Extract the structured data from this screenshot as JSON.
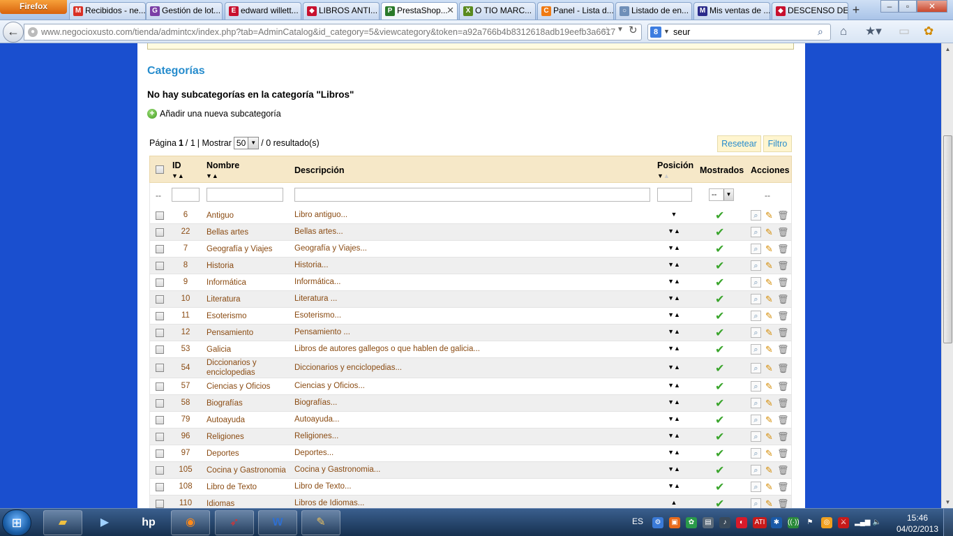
{
  "browser": {
    "menu_label": "Firefox",
    "tabs": [
      {
        "label": "Recibidos - ne...",
        "icon": "gmail-icon",
        "color": "#d93025",
        "glyph": "M"
      },
      {
        "label": "Gestión de lot...",
        "icon": "purple-app-icon",
        "color": "#7b3fa6",
        "glyph": "G"
      },
      {
        "label": "edward willett...",
        "icon": "red-bird-icon",
        "color": "#c8102e",
        "glyph": "E"
      },
      {
        "label": "LIBROS ANTI...",
        "icon": "red-diamond-icon",
        "color": "#c8102e",
        "glyph": "◆"
      },
      {
        "label": "PrestaShop...",
        "icon": "prestashop-icon",
        "color": "#2a7a2a",
        "glyph": "P"
      },
      {
        "label": "O TIO MARC...",
        "icon": "green-x-icon",
        "color": "#5a8a1e",
        "glyph": "X"
      },
      {
        "label": "Panel - Lista d...",
        "icon": "orange-app-icon",
        "color": "#f07a12",
        "glyph": "C"
      },
      {
        "label": "Listado de en...",
        "icon": "globe-icon",
        "color": "#6f8fb8",
        "glyph": "○"
      },
      {
        "label": "Mis ventas de ...",
        "icon": "shop-icon",
        "color": "#2a2a8a",
        "glyph": "M"
      },
      {
        "label": "DESCENSO DE...",
        "icon": "red-diamond-icon",
        "color": "#c8102e",
        "glyph": "◆"
      }
    ],
    "new_tab_label": "+",
    "url_host": "www.negocioxusto.com",
    "url_path": "/tienda/admintcx/index.php?tab=AdminCatalog&id_category=5&viewcategory&token=a92a766b4b8312618adb19eefb3a6617",
    "search_value": "seur"
  },
  "page": {
    "heading": "Categorías",
    "no_subcats": "No hay subcategorías en la categoría \"Libros\"",
    "add_subcat": "Añadir una nueva subcategoría",
    "pager": {
      "page_label": "Página",
      "page_current": "1",
      "page_total": "/ 1",
      "show_label": "| Mostrar",
      "show_value": "50",
      "results": "/ 0 resultado(s)"
    },
    "reset_label": "Resetear",
    "filter_label": "Filtro",
    "columns": {
      "id": "ID",
      "name": "Nombre",
      "description": "Descripción",
      "position": "Posición",
      "displayed": "Mostrados",
      "actions": "Acciones"
    },
    "filter_dash": "--",
    "displayed_select": "--",
    "rows": [
      {
        "id": "6",
        "name": "Antiguo",
        "desc": "Libro antiguo...",
        "pos": "▼"
      },
      {
        "id": "22",
        "name": "Bellas artes",
        "desc": "Bellas artes...",
        "pos": "▼▲"
      },
      {
        "id": "7",
        "name": "Geografía y Viajes",
        "desc": "Geografía y Viajes...",
        "pos": "▼▲"
      },
      {
        "id": "8",
        "name": "Historia",
        "desc": "Historia...",
        "pos": "▼▲"
      },
      {
        "id": "9",
        "name": "Informática",
        "desc": "Informática...",
        "pos": "▼▲"
      },
      {
        "id": "10",
        "name": "Literatura",
        "desc": "Literatura ...",
        "pos": "▼▲"
      },
      {
        "id": "11",
        "name": "Esoterismo",
        "desc": "Esoterismo...",
        "pos": "▼▲"
      },
      {
        "id": "12",
        "name": "Pensamiento",
        "desc": "Pensamiento ...",
        "pos": "▼▲"
      },
      {
        "id": "53",
        "name": "Galicia",
        "desc": "Libros de autores gallegos o que hablen de galicia...",
        "pos": "▼▲"
      },
      {
        "id": "54",
        "name": "Diccionarios y enciclopedias",
        "desc": "Diccionarios y enciclopedias...",
        "pos": "▼▲"
      },
      {
        "id": "57",
        "name": "Ciencias y Oficios",
        "desc": "Ciencias y Oficios...",
        "pos": "▼▲"
      },
      {
        "id": "58",
        "name": "Biografías",
        "desc": "Biografías...",
        "pos": "▼▲"
      },
      {
        "id": "79",
        "name": "Autoayuda",
        "desc": "Autoayuda...",
        "pos": "▼▲"
      },
      {
        "id": "96",
        "name": "Religiones",
        "desc": "Religiones...",
        "pos": "▼▲"
      },
      {
        "id": "97",
        "name": "Deportes",
        "desc": "Deportes...",
        "pos": "▼▲"
      },
      {
        "id": "105",
        "name": "Cocina y Gastronomia",
        "desc": "Cocina y Gastronomia...",
        "pos": "▼▲"
      },
      {
        "id": "108",
        "name": "Libro de Texto",
        "desc": "Libro de Texto...",
        "pos": "▼▲"
      },
      {
        "id": "110",
        "name": "Idiomas",
        "desc": "Libros de Idiomas...",
        "pos": "▲"
      }
    ]
  },
  "taskbar": {
    "language": "ES",
    "time": "15:46",
    "date": "04/02/2013",
    "items": [
      "explorer-icon",
      "media-player-icon",
      "hp-icon",
      "firefox-icon",
      "red-bird-app-icon",
      "word-icon",
      "paint-icon"
    ]
  },
  "colors": {
    "link_brown": "#8a4b12",
    "heading_blue": "#268ccd",
    "header_bg": "#f6e8c8",
    "check_green": "#3aa52c",
    "desktop_blue": "#1a4fcf"
  }
}
